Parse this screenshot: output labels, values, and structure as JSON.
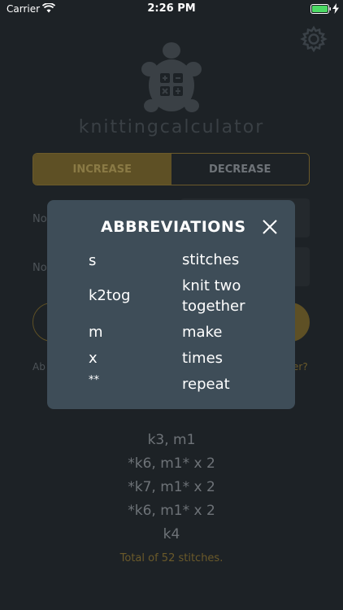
{
  "status_bar": {
    "carrier": "Carrier",
    "time": "2:26 PM"
  },
  "app": {
    "name": "knittingcalculator"
  },
  "mode_toggle": {
    "increase_label": "INCREASE",
    "decrease_label": "DECREASE",
    "selected": "INCREASE"
  },
  "form": {
    "field1_label": "No",
    "field2_label": "No",
    "link_left": "Ab",
    "link_right": "er?"
  },
  "results": {
    "lines": [
      "k3, m1",
      "*k6, m1* x 2",
      "*k7, m1* x 2",
      "*k6, m1* x 2",
      "k4"
    ],
    "total": "Total of 52 stitches."
  },
  "modal": {
    "title": "ABBREVIATIONS",
    "rows": [
      {
        "abbr": "s",
        "meaning": "stitches"
      },
      {
        "abbr": "k2tog",
        "meaning_line1": "knit two",
        "meaning_line2": "together"
      },
      {
        "abbr": "m",
        "meaning": "make"
      },
      {
        "abbr": "x",
        "meaning": "times"
      },
      {
        "abbr": "**",
        "meaning": "repeat"
      }
    ]
  },
  "colors": {
    "background": "#1d2226",
    "modal": "#3e4d58",
    "accent_gold": "#8a7a45"
  }
}
